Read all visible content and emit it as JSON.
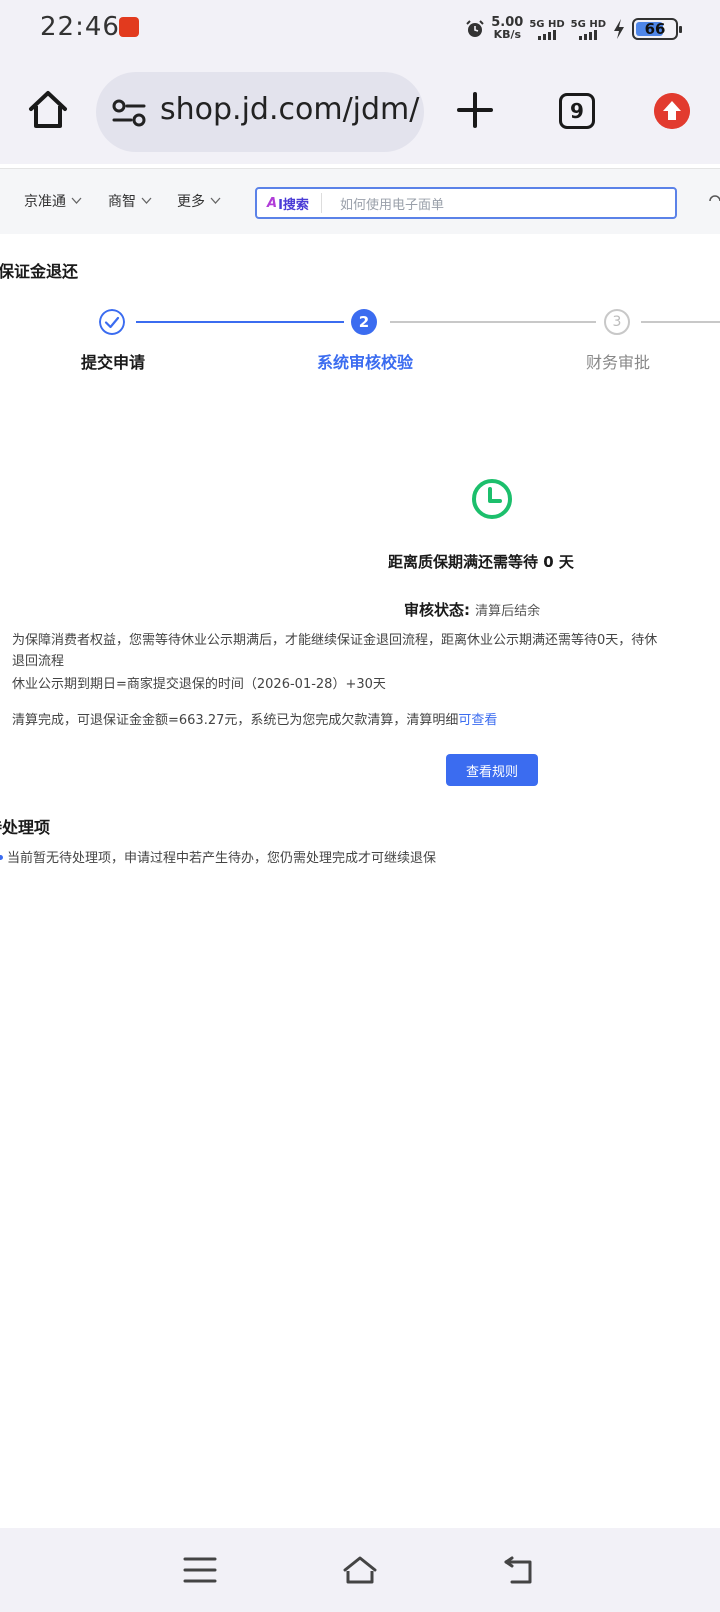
{
  "status_bar": {
    "time": "22:46",
    "net_speed_value": "5.00",
    "net_speed_unit": "KB/s",
    "sim1": "5G HD",
    "sim2": "5G HD",
    "battery": "66"
  },
  "browser": {
    "url": "shop.jd.com/jdm/",
    "tab_count": "9"
  },
  "nav": {
    "items": [
      {
        "label": "京准通"
      },
      {
        "label": "商智"
      },
      {
        "label": "更多"
      }
    ],
    "search": {
      "ai_label_a": "A",
      "ai_label_rest": "I搜索",
      "placeholder": "如何使用电子面单"
    }
  },
  "page": {
    "title": "保证金退还",
    "steps": [
      {
        "number": "1",
        "label": "提交申请",
        "state": "done"
      },
      {
        "number": "2",
        "label": "系统审核校验",
        "state": "active"
      },
      {
        "number": "3",
        "label": "财务审批",
        "state": "pending"
      }
    ],
    "wait_text": "距离质保期满还需等待 0 天",
    "status_label": "审核状态:",
    "status_value": "清算后结余",
    "para1_line1": "为保障消费者权益，您需等待休业公示期满后，才能继续保证金退回流程，距离休业公示期满还需等待0天，待休",
    "para1_line2": "退回流程",
    "para2": "休业公示期到期日=商家提交退保的时间（2026-01-28）+30天",
    "para3_text": "清算完成，可退保证金金额=663.27元，系统已为您完成欠款清算，清算明细",
    "para3_link": "可查看",
    "rules_button": "查看规则",
    "pending_title": "待处理项",
    "pending_text": "当前暂无待处理项，申请过程中若产生待办，您仍需处理完成才可继续退保"
  },
  "colors": {
    "primary": "#3b6cf0",
    "success": "#1cbf6c",
    "pending_gray": "#c8c8c8"
  }
}
